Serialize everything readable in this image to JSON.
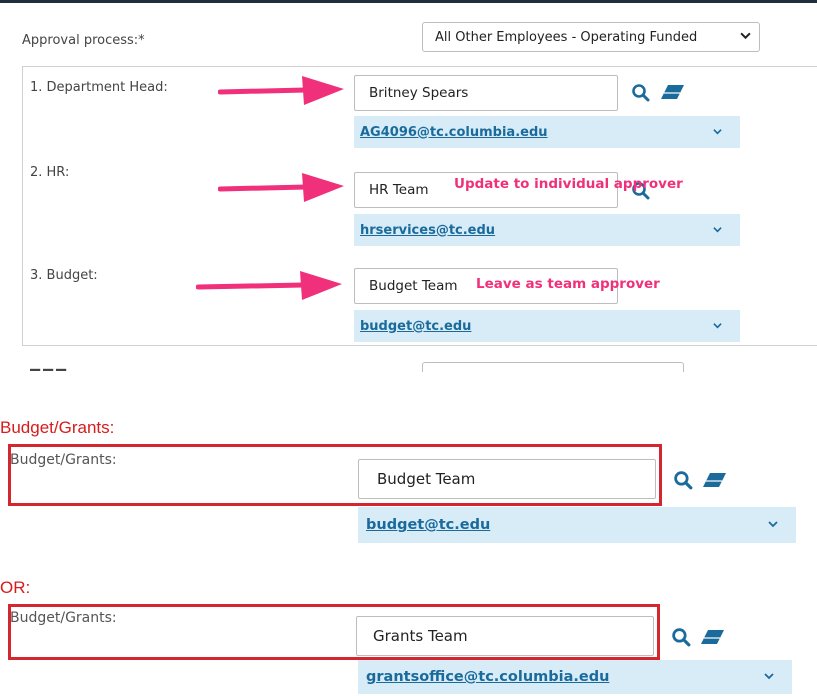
{
  "approval": {
    "label": "Approval process:*",
    "selected": "All Other Employees - Operating Funded"
  },
  "approvers": [
    {
      "label": "1. Department Head:",
      "name": "Britney Spears",
      "email": "AG4096@tc.columbia.edu"
    },
    {
      "label": "2. HR:",
      "name": "HR Team",
      "email": "hrservices@tc.edu",
      "note": "Update to individual approver"
    },
    {
      "label": "3. Budget:",
      "name": "Budget Team",
      "email": "budget@tc.edu",
      "note": "Leave as team approver"
    }
  ],
  "callouts": {
    "budget_heading": "Budget/Grants:",
    "or_heading": "OR:"
  },
  "option_a": {
    "label": "Budget/Grants:",
    "name": "Budget Team",
    "email": "budget@tc.edu"
  },
  "option_b": {
    "label": "Budget/Grants:",
    "name": "Grants Team",
    "email": "grantsoffice@tc.columbia.edu"
  },
  "colors": {
    "arrow": "#f0307a",
    "email_bg": "#d8ecf7",
    "link": "#1a6b9c",
    "frame": "#d4262f",
    "heading": "#d81b1b"
  },
  "icons": [
    "search-icon",
    "eraser-icon",
    "chevron-down-icon",
    "arrow-right-icon"
  ]
}
